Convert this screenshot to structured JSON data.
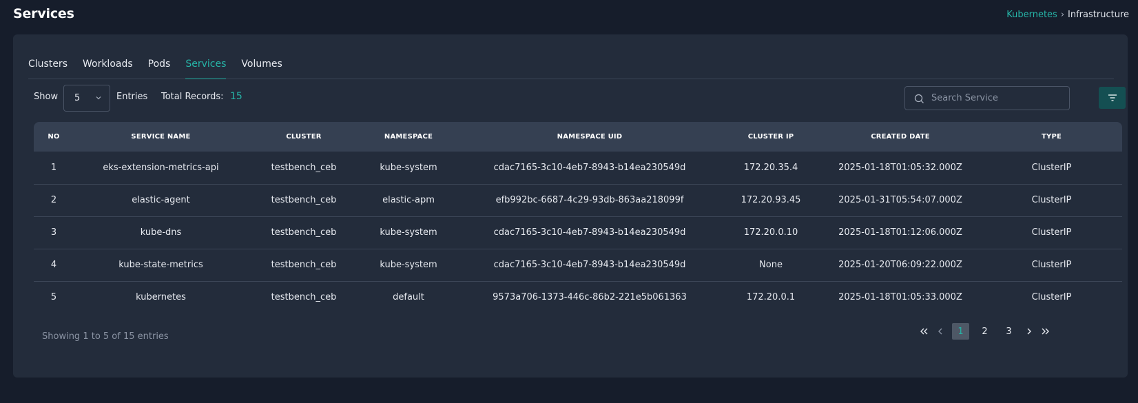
{
  "page": {
    "title": "Services"
  },
  "breadcrumb": {
    "parent": "Kubernetes",
    "separator": "›",
    "current": "Infrastructure"
  },
  "tabs": [
    {
      "label": "Clusters",
      "active": false
    },
    {
      "label": "Workloads",
      "active": false
    },
    {
      "label": "Pods",
      "active": false
    },
    {
      "label": "Services",
      "active": true
    },
    {
      "label": "Volumes",
      "active": false
    }
  ],
  "toolbar": {
    "show_label": "Show",
    "entries_value": "5",
    "entries_label": "Entries",
    "total_label": "Total Records:",
    "total_value": "15",
    "search_placeholder": "Search Service"
  },
  "table": {
    "columns": [
      "NO",
      "SERVICE NAME",
      "CLUSTER",
      "NAMESPACE",
      "NAMESPACE UID",
      "CLUSTER IP",
      "CREATED DATE",
      "TYPE"
    ],
    "rows": [
      [
        "1",
        "eks-extension-metrics-api",
        "testbench_ceb",
        "kube-system",
        "cdac7165-3c10-4eb7-8943-b14ea230549d",
        "172.20.35.4",
        "2025-01-18T01:05:32.000Z",
        "ClusterIP"
      ],
      [
        "2",
        "elastic-agent",
        "testbench_ceb",
        "elastic-apm",
        "efb992bc-6687-4c29-93db-863aa218099f",
        "172.20.93.45",
        "2025-01-31T05:54:07.000Z",
        "ClusterIP"
      ],
      [
        "3",
        "kube-dns",
        "testbench_ceb",
        "kube-system",
        "cdac7165-3c10-4eb7-8943-b14ea230549d",
        "172.20.0.10",
        "2025-01-18T01:12:06.000Z",
        "ClusterIP"
      ],
      [
        "4",
        "kube-state-metrics",
        "testbench_ceb",
        "kube-system",
        "cdac7165-3c10-4eb7-8943-b14ea230549d",
        "None",
        "2025-01-20T06:09:22.000Z",
        "ClusterIP"
      ],
      [
        "5",
        "kubernetes",
        "testbench_ceb",
        "default",
        "9573a706-1373-446c-86b2-221e5b061363",
        "172.20.0.1",
        "2025-01-18T01:05:33.000Z",
        "ClusterIP"
      ]
    ]
  },
  "footer": {
    "showing_text": "Showing 1 to 5 of 15 entries",
    "pages": [
      "1",
      "2",
      "3"
    ],
    "current_page": "1"
  },
  "colors": {
    "accent": "#26b5a8",
    "background": "#161d2b",
    "card": "#232c3b",
    "table_header": "#354052",
    "filter_button": "#144f52"
  },
  "icons": {
    "entries_dropdown": "chevron-down-icon",
    "search": "search-icon",
    "filter": "filter-icon",
    "first_page": "double-chevron-left-icon",
    "prev_page": "chevron-left-icon",
    "next_page": "chevron-right-icon",
    "last_page": "double-chevron-right-icon"
  }
}
